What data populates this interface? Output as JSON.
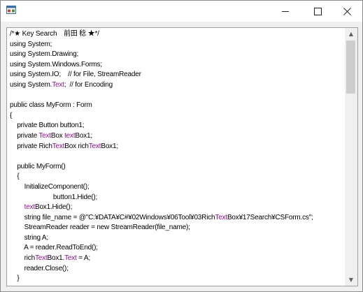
{
  "window": {
    "icon": "form-icon",
    "controls": {
      "minimize": "—",
      "maximize": "☐",
      "close": "✕"
    }
  },
  "editor": {
    "highlight_color": "#8a0f8a",
    "lines": [
      [
        {
          "t": "/*★ Key Search　前田 稔 ★*/"
        }
      ],
      [
        {
          "t": "using System;"
        }
      ],
      [
        {
          "t": "using System.Drawing;"
        }
      ],
      [
        {
          "t": "using System.Windows.Forms;"
        }
      ],
      [
        {
          "t": "using System.IO;    // for File, StreamReader"
        }
      ],
      [
        {
          "t": "using System."
        },
        {
          "t": "Text",
          "k": 1
        },
        {
          "t": ";  // for Encoding"
        }
      ],
      [
        {
          "t": ""
        }
      ],
      [
        {
          "t": "public class MyForm : Form"
        }
      ],
      [
        {
          "t": "{"
        }
      ],
      [
        {
          "t": "    private Button button1;"
        }
      ],
      [
        {
          "t": "    private "
        },
        {
          "t": "Text",
          "k": 1
        },
        {
          "t": "Box "
        },
        {
          "t": "text",
          "k": 1
        },
        {
          "t": "Box1;"
        }
      ],
      [
        {
          "t": "    private Rich"
        },
        {
          "t": "Text",
          "k": 1
        },
        {
          "t": "Box rich"
        },
        {
          "t": "Text",
          "k": 1
        },
        {
          "t": "Box1;"
        }
      ],
      [
        {
          "t": ""
        }
      ],
      [
        {
          "t": "    public MyForm()"
        }
      ],
      [
        {
          "t": "    {"
        }
      ],
      [
        {
          "t": "        InitializeComponent();"
        }
      ],
      [
        {
          "t": "                        button1.Hide();"
        }
      ],
      [
        {
          "t": "        "
        },
        {
          "t": "text",
          "k": 1
        },
        {
          "t": "Box1.Hide();"
        }
      ],
      [
        {
          "t": "        string file_name = @\"C:¥DATA¥C#¥02Windows¥06Tool¥03Rich"
        },
        {
          "t": "Text",
          "k": 1
        },
        {
          "t": "Box¥17Search¥CSForm.cs\";"
        }
      ],
      [
        {
          "t": "        StreamReader reader = new StreamReader(file_name);"
        }
      ],
      [
        {
          "t": "        string A;"
        }
      ],
      [
        {
          "t": "        A = reader.ReadToEnd();"
        }
      ],
      [
        {
          "t": "        rich"
        },
        {
          "t": "Text",
          "k": 1
        },
        {
          "t": "Box1."
        },
        {
          "t": "Text",
          "k": 1
        },
        {
          "t": " = A;"
        }
      ],
      [
        {
          "t": "        reader.Close();"
        }
      ],
      [
        {
          "t": "    }"
        }
      ]
    ]
  },
  "scrollbar": {
    "up_arrow": "▲",
    "down_arrow": "▼",
    "position_fraction": 0.0
  }
}
